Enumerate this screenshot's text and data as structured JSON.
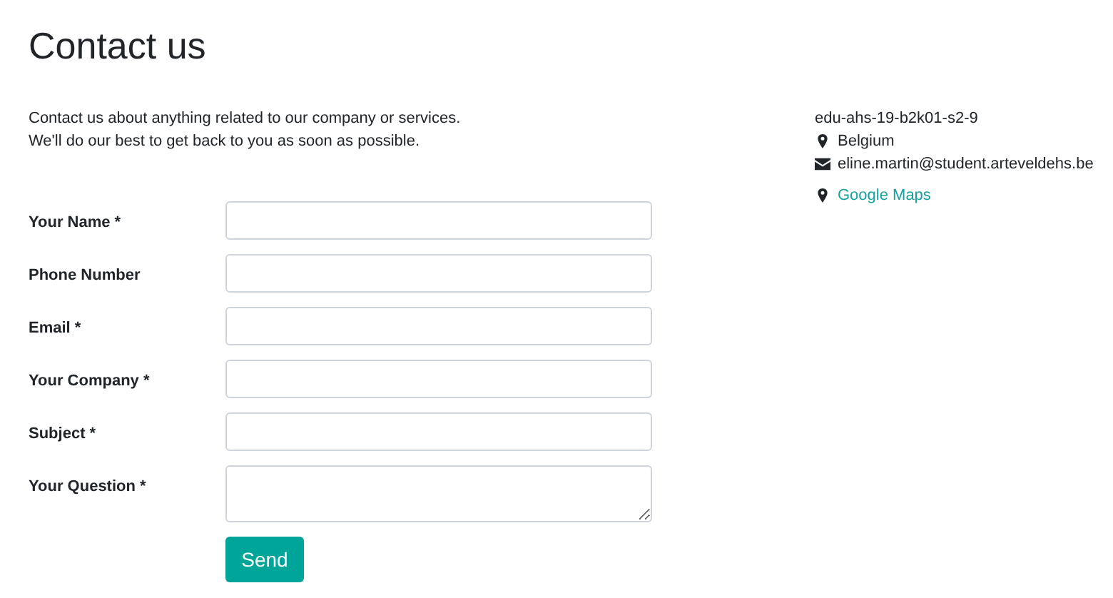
{
  "title": "Contact us",
  "intro": [
    "Contact us about anything related to our company or services.",
    "We'll do our best to get back to you as soon as possible."
  ],
  "form": {
    "fields": [
      {
        "label": "Your Name *",
        "kind": "input"
      },
      {
        "label": "Phone Number",
        "kind": "input"
      },
      {
        "label": "Email *",
        "kind": "input"
      },
      {
        "label": "Your Company *",
        "kind": "input"
      },
      {
        "label": "Subject *",
        "kind": "input"
      },
      {
        "label": "Your Question *",
        "kind": "textarea"
      }
    ],
    "submit": "Send"
  },
  "contact": [
    {
      "kind": "text",
      "text": "edu-ahs-19-b2k01-s2-9"
    },
    {
      "kind": "location",
      "text": "Belgium"
    },
    {
      "kind": "email",
      "text": "eline.martin@student.arteveldehs.be"
    },
    {
      "kind": "map-link",
      "text": "Google Maps"
    }
  ]
}
